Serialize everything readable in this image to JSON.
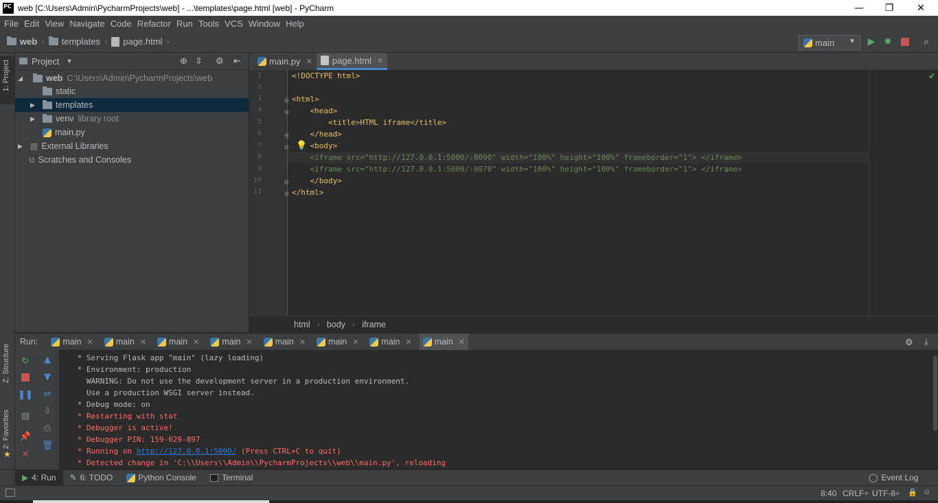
{
  "window": {
    "title": "web [C:\\Users\\Admin\\PycharmProjects\\web] - ...\\templates\\page.html [web] - PyCharm",
    "app_icon_text": "PC",
    "controls": {
      "minimize": "—",
      "maximize": "❐",
      "close": "✕"
    }
  },
  "menu": [
    "File",
    "Edit",
    "View",
    "Navigate",
    "Code",
    "Refactor",
    "Run",
    "Tools",
    "VCS",
    "Window",
    "Help"
  ],
  "navbar": {
    "crumbs": [
      "web",
      "templates",
      "page.html"
    ],
    "run_config": "main"
  },
  "left_strip": {
    "project": "1: Project",
    "structure": "Z: Structure",
    "favorites": "2: Favorites"
  },
  "project_panel": {
    "header": "Project",
    "tree": [
      {
        "label": "web",
        "hint": "C:\\Users\\Admin\\PycharmProjects\\web",
        "kind": "folder",
        "expanded": true
      },
      {
        "label": "static",
        "hint": "",
        "kind": "folder"
      },
      {
        "label": "templates",
        "hint": "",
        "kind": "folder",
        "selected": true
      },
      {
        "label": "venv",
        "hint": "library root",
        "kind": "folder"
      },
      {
        "label": "main.py",
        "hint": "",
        "kind": "python-file"
      },
      {
        "label": "External Libraries",
        "hint": "",
        "kind": "library"
      },
      {
        "label": "Scratches and Consoles",
        "hint": "",
        "kind": "scratch"
      }
    ]
  },
  "editor": {
    "tabs": [
      {
        "label": "main.py",
        "active": false
      },
      {
        "label": "page.html",
        "active": true
      }
    ],
    "line_numbers": [
      "1",
      "2",
      "3",
      "4",
      "5",
      "6",
      "7",
      "8",
      "9",
      "10",
      "11"
    ],
    "lines": [
      "<!DOCTYPE html>",
      "",
      "<html>",
      "    <head>",
      "        <title>HTML iframe</title>",
      "    </head>",
      "    <body>",
      "    <iframe src=\"http://127.0.0.1:5000/:8090\" width=\"100%\" height=\"100%\" frameborder=\"1\"> </iframe>",
      "    <iframe src=\"http://127.0.0.1:5000/:8070\" width=\"100%\" height=\"100%\" frameborder=\"1\"> </iframe>",
      "    </body>",
      "</html>"
    ],
    "breadcrumbs": [
      "html",
      "body",
      "iframe"
    ]
  },
  "run_panel": {
    "label": "Run:",
    "tabs": [
      "main",
      "main",
      "main",
      "main",
      "main",
      "main",
      "main",
      "main"
    ],
    "console": [
      {
        "text": " * Serving Flask app \"main\" (lazy loading)",
        "color": "normal"
      },
      {
        "text": " * Environment: production",
        "color": "normal"
      },
      {
        "text": "   WARNING: Do not use the development server in a production environment.",
        "color": "normal"
      },
      {
        "text": "   Use a production WSGI server instead.",
        "color": "normal"
      },
      {
        "text": " * Debug mode: on",
        "color": "normal"
      },
      {
        "text": " * Restarting with stat",
        "color": "red"
      },
      {
        "text": " * Debugger is active!",
        "color": "red"
      },
      {
        "text": " * Debugger PIN: 159-029-897",
        "color": "red"
      },
      {
        "text": " * Detected change in 'C:\\\\Users\\\\Admin\\\\PycharmProjects\\\\web\\\\main.py', reloading",
        "color": "red"
      }
    ],
    "running_prefix": " * Running on ",
    "running_link": "http://127.0.0.1:5000/",
    "running_suffix": " (Press CTRL+C to quit)"
  },
  "bottom_tabs": [
    "4: Run",
    "6: TODO",
    "Python Console",
    "Terminal"
  ],
  "event_log": "Event Log",
  "status": {
    "position": "8:40",
    "line_sep": "CRLF÷",
    "encoding": "UTF-8÷"
  },
  "colors": {
    "accent": "#4a88c7",
    "run_green": "#59a869",
    "stop_red": "#c75450",
    "error_red": "#ff6b68",
    "link": "#287bde"
  }
}
